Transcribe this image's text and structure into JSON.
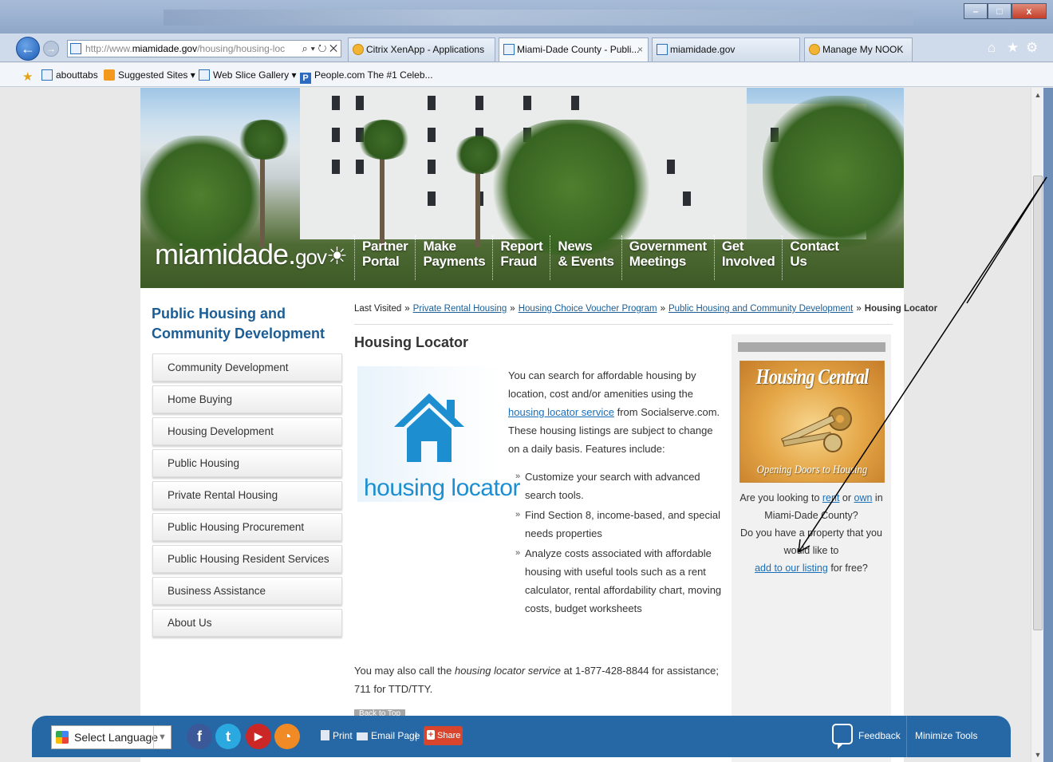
{
  "browser": {
    "url_prefix": "http://www.",
    "url_domain": "miamidade.gov",
    "url_path": "/housing/housing-loc",
    "address_controls": "⌕ ▾ ↻ ✕",
    "back_glyph": "←",
    "forward_glyph": "→",
    "tabs": [
      {
        "label": "Citrix XenApp - Applications",
        "icon": "ie-icon",
        "active": false
      },
      {
        "label": "Miami-Dade County - Publi...",
        "icon": "page-icon",
        "active": true,
        "close": "×"
      },
      {
        "label": "miamidade.gov",
        "icon": "page-icon",
        "active": false
      },
      {
        "label": "Manage My NOOK",
        "icon": "ie-icon",
        "active": false
      }
    ],
    "right_icons": {
      "home": "⌂",
      "favorites": "★",
      "tools": "⚙"
    },
    "window_buttons": {
      "minimize": "–",
      "maximize": "□",
      "close": "x"
    }
  },
  "favorites_bar": {
    "items": [
      {
        "label": "abouttabs",
        "icon": "ie-icon"
      },
      {
        "label": "Suggested Sites ▾",
        "icon": "suggested-sites-icon"
      },
      {
        "label": "Web Slice Gallery ▾",
        "icon": "ie-icon"
      },
      {
        "label": "People.com  The #1 Celeb...",
        "icon": "people-icon"
      }
    ]
  },
  "site": {
    "logo_main": "miamidade.",
    "logo_tld": "gov",
    "topnav": [
      {
        "line1": "Partner",
        "line2": "Portal"
      },
      {
        "line1": "Make",
        "line2": "Payments"
      },
      {
        "line1": "Report",
        "line2": "Fraud"
      },
      {
        "line1": "News",
        "line2": "& Events"
      },
      {
        "line1": "Government",
        "line2": "Meetings"
      },
      {
        "line1": "Get",
        "line2": "Involved"
      },
      {
        "line1": "Contact",
        "line2": "Us"
      }
    ],
    "sidebar_title": "Public Housing and Community Development",
    "sidebar_items": [
      "Community Development",
      "Home Buying",
      "Housing Development",
      "Public Housing",
      "Private Rental Housing",
      "Public Housing Procurement",
      "Public Housing Resident Services",
      "Business Assistance",
      "About Us"
    ],
    "breadcrumb": {
      "prefix": "Last Visited",
      "links": [
        "Private Rental Housing",
        "Housing Choice Voucher Program",
        "Public Housing and Community Development"
      ],
      "current": "Housing Locator",
      "separator": "»"
    },
    "page_title": "Housing Locator",
    "logo_image_text": "housing locator",
    "intro": {
      "before_link": "You can search for affordable housing by location, cost and/or amenities using the ",
      "link": "housing locator service",
      "after_link": " from Socialserve.com. These housing listings are subject to change on a daily basis. Features include:"
    },
    "features": [
      "Customize your search with advanced search tools.",
      "Find Section 8, income-based, and special needs properties",
      "Analyze costs associated with affordable housing with useful tools such as a rent calculator, rental affordability chart, moving costs, budget worksheets"
    ],
    "call": {
      "before": "You may also call the ",
      "service": "housing locator service",
      "after": " at 1-877-428-8844 for assistance; 711 for TTD/TTY."
    },
    "back_to_top": "Back to Top",
    "promo": {
      "title": "Housing Central",
      "subtitle": "Opening Doors to Housing",
      "q1_before": "Are you looking to ",
      "rent": "rent",
      "or": " or ",
      "own": "own",
      "q1_after": " in Miami-Dade County?",
      "q2": "Do you have a property that you would like to",
      "add_link": "add to our listing",
      "q2_after": " for free?"
    }
  },
  "tools_bar": {
    "select_language": "Select Language",
    "dropdown_glyph": "▼",
    "social": [
      {
        "name": "facebook",
        "glyph": "f",
        "color": "#3b5998"
      },
      {
        "name": "twitter",
        "glyph": "t",
        "color": "#2aa9e0"
      },
      {
        "name": "youtube",
        "glyph": "▶",
        "color": "#cc2727"
      },
      {
        "name": "rss",
        "glyph": "◔",
        "color": "#f08a24"
      }
    ],
    "print": "Print",
    "email": "Email Page",
    "divider": "|",
    "share": "Share",
    "feedback": "Feedback",
    "minimize": "Minimize Tools"
  },
  "colors": {
    "link": "#1b6fb8",
    "sidebar_title": "#1b5d94",
    "tools_bar": "#2667a5",
    "share": "#d9442c"
  }
}
